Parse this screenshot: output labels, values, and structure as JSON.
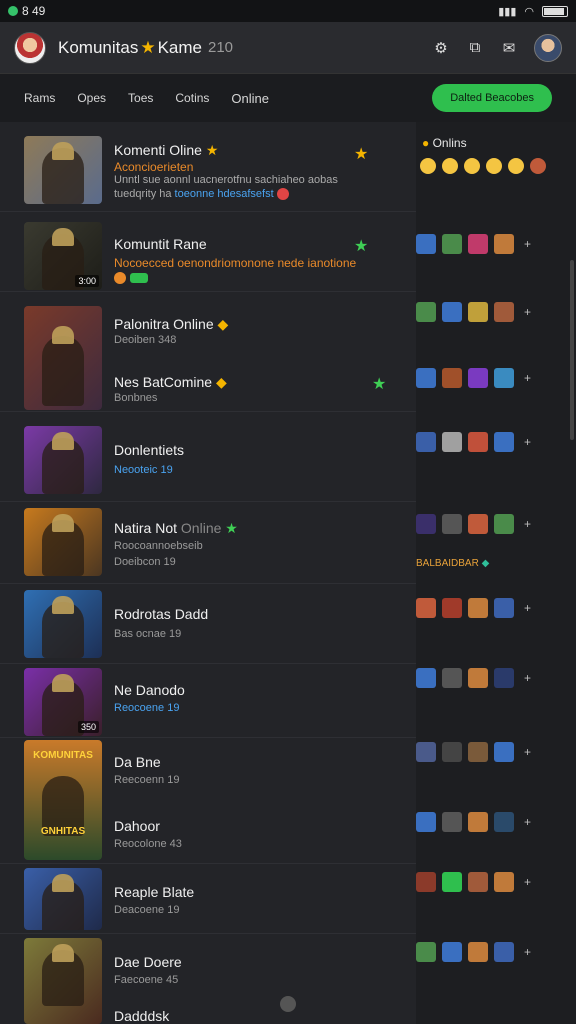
{
  "status": {
    "left": "8 49",
    "wifi": "wifi",
    "signal": "signal"
  },
  "header": {
    "title_a": "Komunitas",
    "title_b": "Kame",
    "sub": "210"
  },
  "tabs": [
    "Rams",
    "Opes",
    "Toes",
    "Cotins",
    "Online"
  ],
  "cta": "Dalted Beacobes",
  "rows": [
    {
      "title": "Komenti Oline",
      "sub": "Aconcioerieten",
      "desc": "Unntl sue aonnl uacnerotfnu sachiaheo aobas",
      "desc2": "tuedqrity ha",
      "link": "toeonne hdesafsefst",
      "thumb": [
        "#8e7a58",
        "#5a6b8c"
      ],
      "mark": "★",
      "mark_color": "gold"
    },
    {
      "title": "Komuntit Rane",
      "sub": "Nocoecced oenondriomonone nede ianotione",
      "desc": "",
      "thumb": [
        "#3a3a30",
        "#1d1d18"
      ],
      "badge": "3:00",
      "mark": "★",
      "mark_color": "green"
    },
    {
      "title": "Palonitra Online",
      "sub": "Deoiben 348",
      "thumb": [
        "#7a3a2a",
        "#3d2a3e"
      ],
      "mark": "◆",
      "mark_color": "gold"
    },
    {
      "title": "Nes BatComine",
      "sub": "Bonbnes",
      "mark": "◆",
      "mark_color": "gold",
      "mark2": "★"
    },
    {
      "title": "Donlentiets",
      "sub": "Neooteic 19",
      "thumb": [
        "#7b3aa6",
        "#2e2840"
      ]
    },
    {
      "title": "Natira Not",
      "title_extra": "Online",
      "sub": "Roocoannoebseib",
      "desc": "Doeibcon 19",
      "thumb": [
        "#c77a1e",
        "#4b3621"
      ],
      "mark": "★",
      "mark_color": "green"
    },
    {
      "title": "Rodrotas Dadd",
      "sub": "Bas ocnae 19",
      "thumb": [
        "#2f6fb3",
        "#1d2f55"
      ]
    },
    {
      "title": "Ne Danodo",
      "sub": "Reocoene 19",
      "thumb": [
        "#7a2fa8",
        "#3a1f2a"
      ],
      "badge": "350"
    },
    {
      "title": "Da Bne",
      "sub": "Reecoenn 19",
      "thumb": [
        "#c97a2a",
        "#2c4a2a"
      ],
      "banner_top": "KOMUNITAS",
      "banner_bottom": "GNHITAS"
    },
    {
      "title": "Dahoor",
      "sub": "Reocolone 43",
      "thumb": [
        "#c97a2a",
        "#2c4a2a"
      ]
    },
    {
      "title": "Reaple Blate",
      "sub": "Deacoene 19",
      "thumb": [
        "#3a5fa8",
        "#1f2a4a"
      ]
    },
    {
      "title": "Dae Doere",
      "sub": "Faecoene 45",
      "thumb": [
        "#7d7a3a",
        "#4a2a1f"
      ]
    },
    {
      "title": "Dadddsk",
      "sub": ""
    }
  ],
  "side": {
    "title": "Onlins",
    "banner": "BALBAIDBAR",
    "groups": [
      {
        "icons": [
          "#3a6fc0",
          "#4a8b4a",
          "#c03a6a",
          "#c07a3a"
        ],
        "more": "+"
      },
      {
        "icons": [
          "#4a8b4a",
          "#3a6fc0",
          "#c0a03a",
          "#a05a3a"
        ],
        "more": "+"
      },
      {
        "icons": [
          "#3a6fc0",
          "#a0502a",
          "#7a3ac0",
          "#3a8bc0"
        ],
        "more": "+"
      },
      {
        "icons": [
          "#3a5fa8",
          "#a0a0a0",
          "#c0503a",
          "#3a6fc0"
        ],
        "more": "+"
      },
      {
        "icons": [
          "#3a2f6a",
          "#555555",
          "#c05a3a",
          "#4a8b4a"
        ],
        "more": "+"
      },
      {
        "icons": [
          "#c05a3a",
          "#a03a2a",
          "#c07a3a",
          "#3a5fa8"
        ],
        "more": "+"
      },
      {
        "icons": [
          "#3a6fc0",
          "#555555",
          "#c07a3a",
          "#2a3a6a"
        ],
        "more": "+"
      },
      {
        "icons": [
          "#4a5a8a",
          "#444444",
          "#7a5a3a",
          "#3a6fc0"
        ],
        "more": "+"
      },
      {
        "icons": [
          "#3a6fc0",
          "#555555",
          "#c07a3a",
          "#2a4a6a"
        ],
        "more": "+"
      },
      {
        "icons": [
          "#8b3a2a",
          "#2fbf4e",
          "#a05a3a",
          "#c07a3a"
        ],
        "more": "+"
      },
      {
        "icons": [
          "#4a8b4a",
          "#3a6fc0",
          "#c07a3a",
          "#3a5fa8"
        ],
        "more": "+"
      }
    ]
  }
}
